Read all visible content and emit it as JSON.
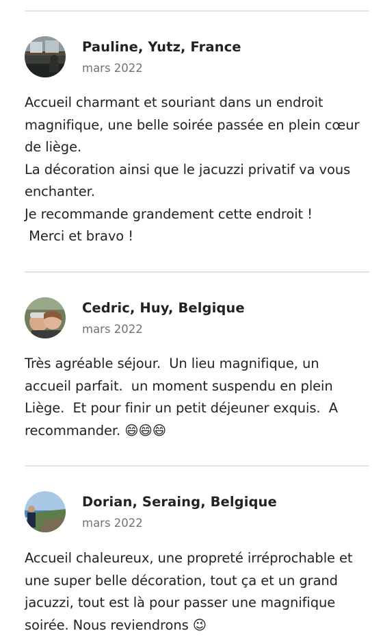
{
  "reviews": [
    {
      "author": "Pauline, Yutz, France",
      "date": "mars 2022",
      "avatar_icon": "profile-photo-icon",
      "text": "Accueil charmant et souriant dans un endroit\nmagnifique, une belle soirée passée en plein cœur\nde liège.\nLa décoration ainsi que le jacuzzi privatif va vous\nenchanter.\nJe recommande grandement cette endroit !\n Merci et bravo !"
    },
    {
      "author": "Cedric, Huy, Belgique",
      "date": "mars 2022",
      "avatar_icon": "profile-photo-icon",
      "text": "Très agréable séjour.  Un lieu magnifique, un\naccueil parfait.  un moment suspendu en plein\nLiège.  Et pour finir un petit déjeuner exquis.  A\nrecommander. 😄😄😄"
    },
    {
      "author": "Dorian, Seraing, Belgique",
      "date": "mars 2022",
      "avatar_icon": "profile-photo-icon",
      "text": "Accueil chaleureux, une propreté irréprochable et\nune super belle décoration, tout ça et un grand\njacuzzi, tout est là pour passer une magnifique\nsoirée. Nous reviendrons 😉"
    }
  ],
  "colors": {
    "text": "#222222",
    "secondary_text": "#717171",
    "divider": "#e3e3e3"
  }
}
